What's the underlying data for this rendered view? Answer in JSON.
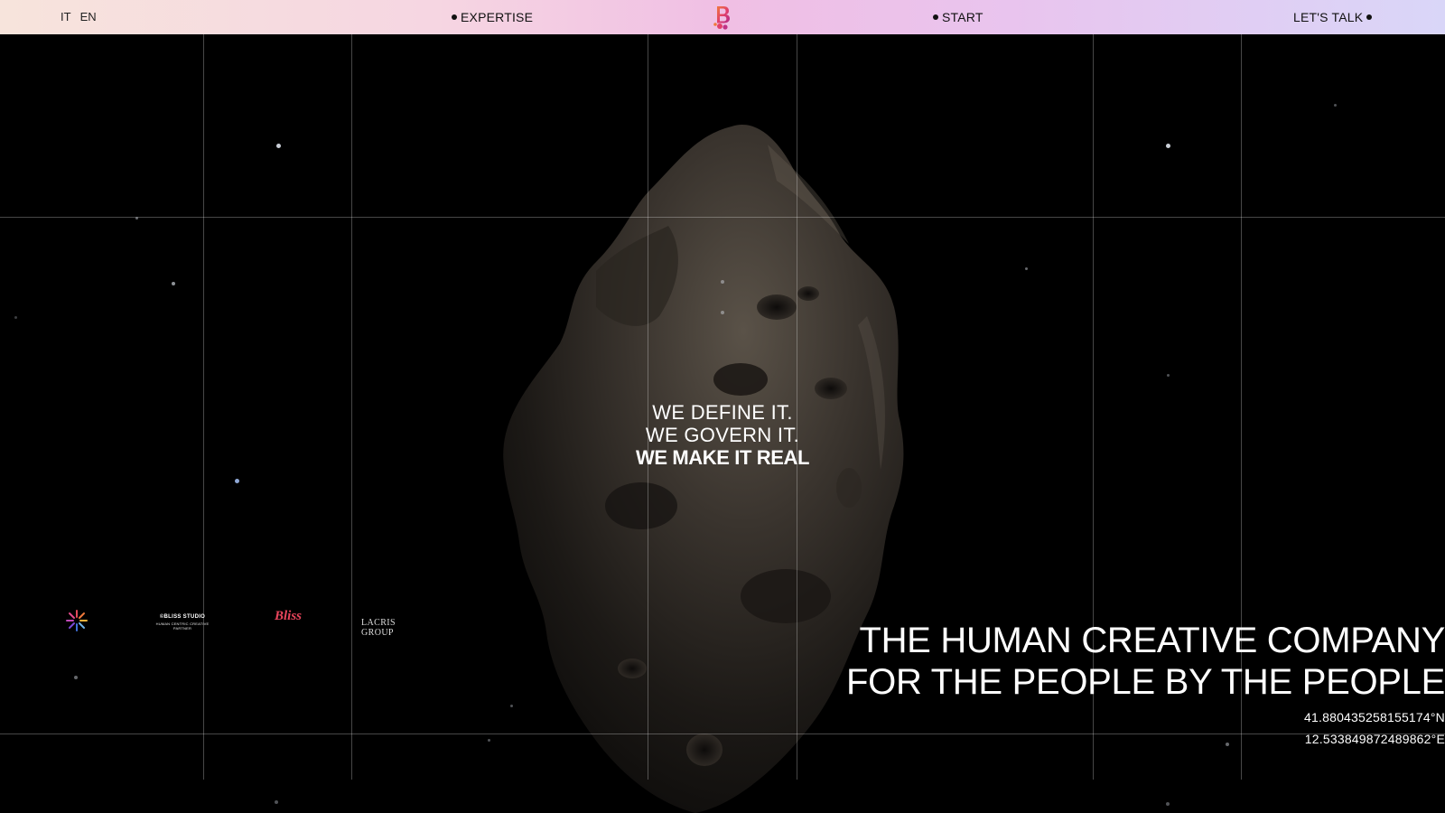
{
  "header": {
    "lang_it": "IT",
    "lang_en": "EN",
    "nav_expertise": "EXPERTISE",
    "nav_start": "START",
    "nav_talk": "LET'S TALK",
    "logo_icon": "bliss-b-logo-icon"
  },
  "hero": {
    "tagline": {
      "line1": "WE DEFINE IT.",
      "line2": "WE GOVERN IT.",
      "line3": "WE MAKE IT REAL"
    },
    "headline": {
      "line1": "THE HUMAN CREATIVE COMPANY",
      "line2": "FOR THE PEOPLE BY THE PEOPLE"
    },
    "coordinates": {
      "lat": "41.880435258155174°N",
      "lon": "12.533849872489862°E"
    }
  },
  "brands": {
    "studio_name": "©BLISS STUDIO",
    "studio_tagline": "HUMAN CENTRIC CREATIVE PARTNER",
    "bliss_wordmark": "Bliss",
    "lacris": "LACRIS GROUP"
  },
  "colors": {
    "background": "#000000",
    "header_start": "#f7e4dc",
    "header_mid": "#f0bfe4",
    "header_end": "#d9d6f8",
    "accent": "#e8455c"
  }
}
